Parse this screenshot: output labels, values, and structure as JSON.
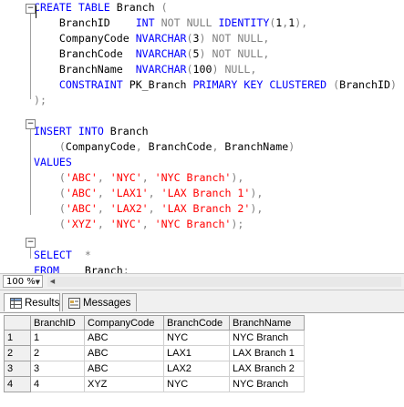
{
  "editor": {
    "lines": [
      {
        "parts": [
          {
            "t": "CREATE",
            "c": "kw"
          },
          {
            "t": " "
          },
          {
            "t": "TABLE",
            "c": "kw"
          },
          {
            "t": " Branch "
          },
          {
            "t": "(",
            "c": "gr"
          }
        ]
      },
      {
        "parts": [
          {
            "t": "    BranchID    "
          },
          {
            "t": "INT",
            "c": "kw"
          },
          {
            "t": " "
          },
          {
            "t": "NOT",
            "c": "gr"
          },
          {
            "t": " "
          },
          {
            "t": "NULL",
            "c": "gr"
          },
          {
            "t": " "
          },
          {
            "t": "IDENTITY",
            "c": "kw"
          },
          {
            "t": "(",
            "c": "gr"
          },
          {
            "t": "1"
          },
          {
            "t": ",",
            "c": "gr"
          },
          {
            "t": "1"
          },
          {
            "t": "),",
            "c": "gr"
          }
        ]
      },
      {
        "parts": [
          {
            "t": "    CompanyCode "
          },
          {
            "t": "NVARCHAR",
            "c": "kw"
          },
          {
            "t": "(",
            "c": "gr"
          },
          {
            "t": "3"
          },
          {
            "t": ")",
            "c": "gr"
          },
          {
            "t": " "
          },
          {
            "t": "NOT",
            "c": "gr"
          },
          {
            "t": " "
          },
          {
            "t": "NULL",
            "c": "gr"
          },
          {
            "t": ",",
            "c": "gr"
          }
        ]
      },
      {
        "parts": [
          {
            "t": "    BranchCode  "
          },
          {
            "t": "NVARCHAR",
            "c": "kw"
          },
          {
            "t": "(",
            "c": "gr"
          },
          {
            "t": "5"
          },
          {
            "t": ")",
            "c": "gr"
          },
          {
            "t": " "
          },
          {
            "t": "NOT",
            "c": "gr"
          },
          {
            "t": " "
          },
          {
            "t": "NULL",
            "c": "gr"
          },
          {
            "t": ",",
            "c": "gr"
          }
        ]
      },
      {
        "parts": [
          {
            "t": "    BranchName  "
          },
          {
            "t": "NVARCHAR",
            "c": "kw"
          },
          {
            "t": "(",
            "c": "gr"
          },
          {
            "t": "100"
          },
          {
            "t": ")",
            "c": "gr"
          },
          {
            "t": " "
          },
          {
            "t": "NULL",
            "c": "gr"
          },
          {
            "t": ",",
            "c": "gr"
          }
        ]
      },
      {
        "parts": [
          {
            "t": "    "
          },
          {
            "t": "CONSTRAINT",
            "c": "kw"
          },
          {
            "t": " PK_Branch "
          },
          {
            "t": "PRIMARY",
            "c": "kw"
          },
          {
            "t": " "
          },
          {
            "t": "KEY",
            "c": "kw"
          },
          {
            "t": " "
          },
          {
            "t": "CLUSTERED",
            "c": "kw"
          },
          {
            "t": " "
          },
          {
            "t": "(",
            "c": "gr"
          },
          {
            "t": "BranchID"
          },
          {
            "t": ")",
            "c": "gr"
          }
        ]
      },
      {
        "parts": [
          {
            "t": ");",
            "c": "gr"
          }
        ]
      },
      {
        "parts": []
      },
      {
        "parts": [
          {
            "t": "INSERT",
            "c": "kw"
          },
          {
            "t": " "
          },
          {
            "t": "INTO",
            "c": "kw"
          },
          {
            "t": " Branch"
          }
        ]
      },
      {
        "parts": [
          {
            "t": "    "
          },
          {
            "t": "(",
            "c": "gr"
          },
          {
            "t": "CompanyCode"
          },
          {
            "t": ",",
            "c": "gr"
          },
          {
            "t": " BranchCode"
          },
          {
            "t": ",",
            "c": "gr"
          },
          {
            "t": " BranchName"
          },
          {
            "t": ")",
            "c": "gr"
          }
        ]
      },
      {
        "parts": [
          {
            "t": "VALUES",
            "c": "kw"
          }
        ]
      },
      {
        "parts": [
          {
            "t": "    "
          },
          {
            "t": "(",
            "c": "gr"
          },
          {
            "t": "'ABC'",
            "c": "st"
          },
          {
            "t": ",",
            "c": "gr"
          },
          {
            "t": " "
          },
          {
            "t": "'NYC'",
            "c": "st"
          },
          {
            "t": ",",
            "c": "gr"
          },
          {
            "t": " "
          },
          {
            "t": "'NYC Branch'",
            "c": "st"
          },
          {
            "t": "),",
            "c": "gr"
          }
        ]
      },
      {
        "parts": [
          {
            "t": "    "
          },
          {
            "t": "(",
            "c": "gr"
          },
          {
            "t": "'ABC'",
            "c": "st"
          },
          {
            "t": ",",
            "c": "gr"
          },
          {
            "t": " "
          },
          {
            "t": "'LAX1'",
            "c": "st"
          },
          {
            "t": ",",
            "c": "gr"
          },
          {
            "t": " "
          },
          {
            "t": "'LAX Branch 1'",
            "c": "st"
          },
          {
            "t": "),",
            "c": "gr"
          }
        ]
      },
      {
        "parts": [
          {
            "t": "    "
          },
          {
            "t": "(",
            "c": "gr"
          },
          {
            "t": "'ABC'",
            "c": "st"
          },
          {
            "t": ",",
            "c": "gr"
          },
          {
            "t": " "
          },
          {
            "t": "'LAX2'",
            "c": "st"
          },
          {
            "t": ",",
            "c": "gr"
          },
          {
            "t": " "
          },
          {
            "t": "'LAX Branch 2'",
            "c": "st"
          },
          {
            "t": "),",
            "c": "gr"
          }
        ]
      },
      {
        "parts": [
          {
            "t": "    "
          },
          {
            "t": "(",
            "c": "gr"
          },
          {
            "t": "'XYZ'",
            "c": "st"
          },
          {
            "t": ",",
            "c": "gr"
          },
          {
            "t": " "
          },
          {
            "t": "'NYC'",
            "c": "st"
          },
          {
            "t": ",",
            "c": "gr"
          },
          {
            "t": " "
          },
          {
            "t": "'NYC Branch'",
            "c": "st"
          },
          {
            "t": ");",
            "c": "gr"
          }
        ]
      },
      {
        "parts": []
      },
      {
        "parts": [
          {
            "t": "SELECT",
            "c": "kw"
          },
          {
            "t": "  "
          },
          {
            "t": "*",
            "c": "gr"
          }
        ]
      },
      {
        "parts": [
          {
            "t": "FROM",
            "c": "kw"
          },
          {
            "t": "    Branch"
          },
          {
            "t": ";",
            "c": "gr"
          }
        ]
      }
    ]
  },
  "zoom": {
    "value": "100 %"
  },
  "tabs": [
    {
      "label": "Results",
      "icon": "grid-icon",
      "active": true
    },
    {
      "label": "Messages",
      "icon": "messages-icon",
      "active": false
    }
  ],
  "grid": {
    "columns": [
      "",
      "BranchID",
      "CompanyCode",
      "BranchCode",
      "BranchName"
    ],
    "rows": [
      [
        "1",
        "1",
        "ABC",
        "NYC",
        "NYC Branch"
      ],
      [
        "2",
        "2",
        "ABC",
        "LAX1",
        "LAX Branch 1"
      ],
      [
        "3",
        "3",
        "ABC",
        "LAX2",
        "LAX Branch 2"
      ],
      [
        "4",
        "4",
        "XYZ",
        "NYC",
        "NYC Branch"
      ]
    ]
  },
  "colors": {
    "keyword": "#0000ff",
    "operator": "#808080",
    "string": "#ff0000"
  }
}
